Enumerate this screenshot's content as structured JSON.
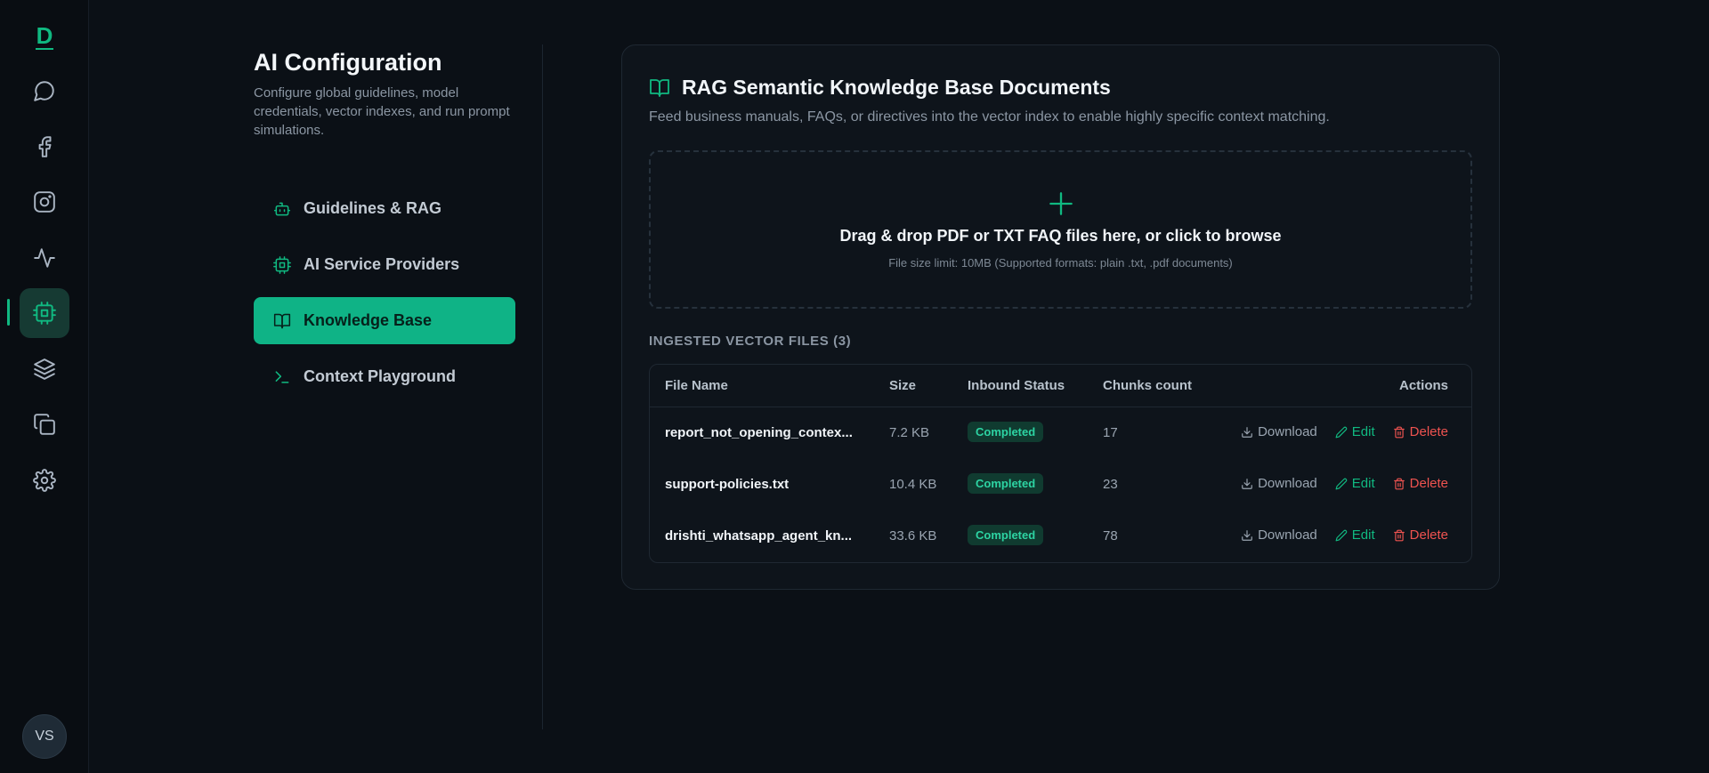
{
  "rail": {
    "logo": "D",
    "avatar": "VS"
  },
  "config": {
    "title": "AI Configuration",
    "description": "Configure global guidelines, model credentials, vector indexes, and run prompt simulations.",
    "nav": [
      {
        "label": "Guidelines & RAG"
      },
      {
        "label": "AI Service Providers"
      },
      {
        "label": "Knowledge Base"
      },
      {
        "label": "Context Playground"
      }
    ]
  },
  "card": {
    "title": "RAG Semantic Knowledge Base Documents",
    "subtitle": "Feed business manuals, FAQs, or directives into the vector index to enable highly specific context matching.",
    "dropzone": {
      "title": "Drag & drop PDF or TXT FAQ files here, or click to browse",
      "subtitle": "File size limit: 10MB (Supported formats: plain .txt, .pdf documents)"
    },
    "section_label": "INGESTED VECTOR FILES (3)",
    "table": {
      "headers": {
        "name": "File Name",
        "size": "Size",
        "status": "Inbound Status",
        "chunks": "Chunks count",
        "actions": "Actions"
      },
      "rows": [
        {
          "name": "report_not_opening_contex...",
          "size": "7.2 KB",
          "status": "Completed",
          "chunks": "17"
        },
        {
          "name": "support-policies.txt",
          "size": "10.4 KB",
          "status": "Completed",
          "chunks": "23"
        },
        {
          "name": "drishti_whatsapp_agent_kn...",
          "size": "33.6 KB",
          "status": "Completed",
          "chunks": "78"
        }
      ],
      "actions": {
        "download": "Download",
        "edit": "Edit",
        "delete": "Delete"
      }
    }
  },
  "colors": {
    "accent": "#10b981",
    "danger": "#ef5350",
    "background": "#0b1016"
  }
}
